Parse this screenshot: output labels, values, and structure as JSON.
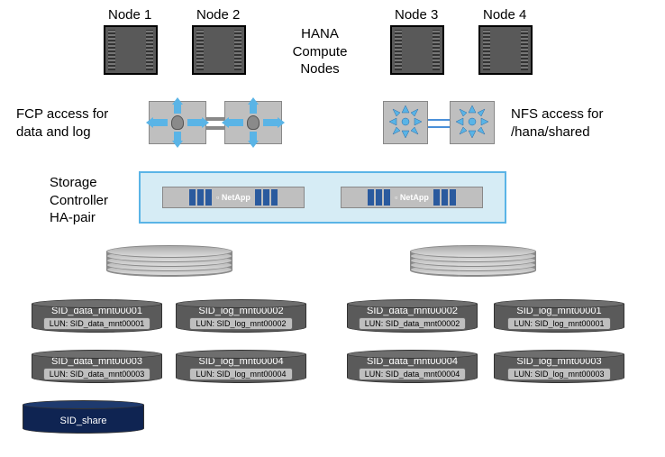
{
  "nodes": [
    {
      "label": "Node 1"
    },
    {
      "label": "Node 2"
    },
    {
      "label": "Node 3"
    },
    {
      "label": "Node 4"
    }
  ],
  "center_label_line1": "HANA",
  "center_label_line2": "Compute",
  "center_label_line3": "Nodes",
  "fcp_label_line1": "FCP access for",
  "fcp_label_line2": "data and log",
  "nfs_label_line1": "NFS access for",
  "nfs_label_line2": "/hana/shared",
  "storage_label_line1": "Storage",
  "storage_label_line2": "Controller",
  "storage_label_line3": "HA-pair",
  "netapp_label": "NetApp",
  "volumes_left": [
    {
      "name": "SID_data_mnt00001",
      "lun": "LUN: SID_data_mnt00001"
    },
    {
      "name": "SID_log_mnt00002",
      "lun": "LUN: SID_log_mnt00002"
    },
    {
      "name": "SID_data_mnt00003",
      "lun": "LUN: SID_data_mnt00003"
    },
    {
      "name": "SID_log_mnt00004",
      "lun": "LUN: SID_log_mnt00004"
    }
  ],
  "volumes_right": [
    {
      "name": "SID_data_mnt00002",
      "lun": "LUN: SID_data_mnt00002"
    },
    {
      "name": "SID_log_mnt00001",
      "lun": "LUN: SID_log_mnt00001"
    },
    {
      "name": "SID_data_mnt00004",
      "lun": "LUN: SID_data_mnt00004"
    },
    {
      "name": "SID_log_mnt00003",
      "lun": "LUN: SID_log_mnt00003"
    }
  ],
  "share_volume": {
    "name": "SID_share"
  }
}
